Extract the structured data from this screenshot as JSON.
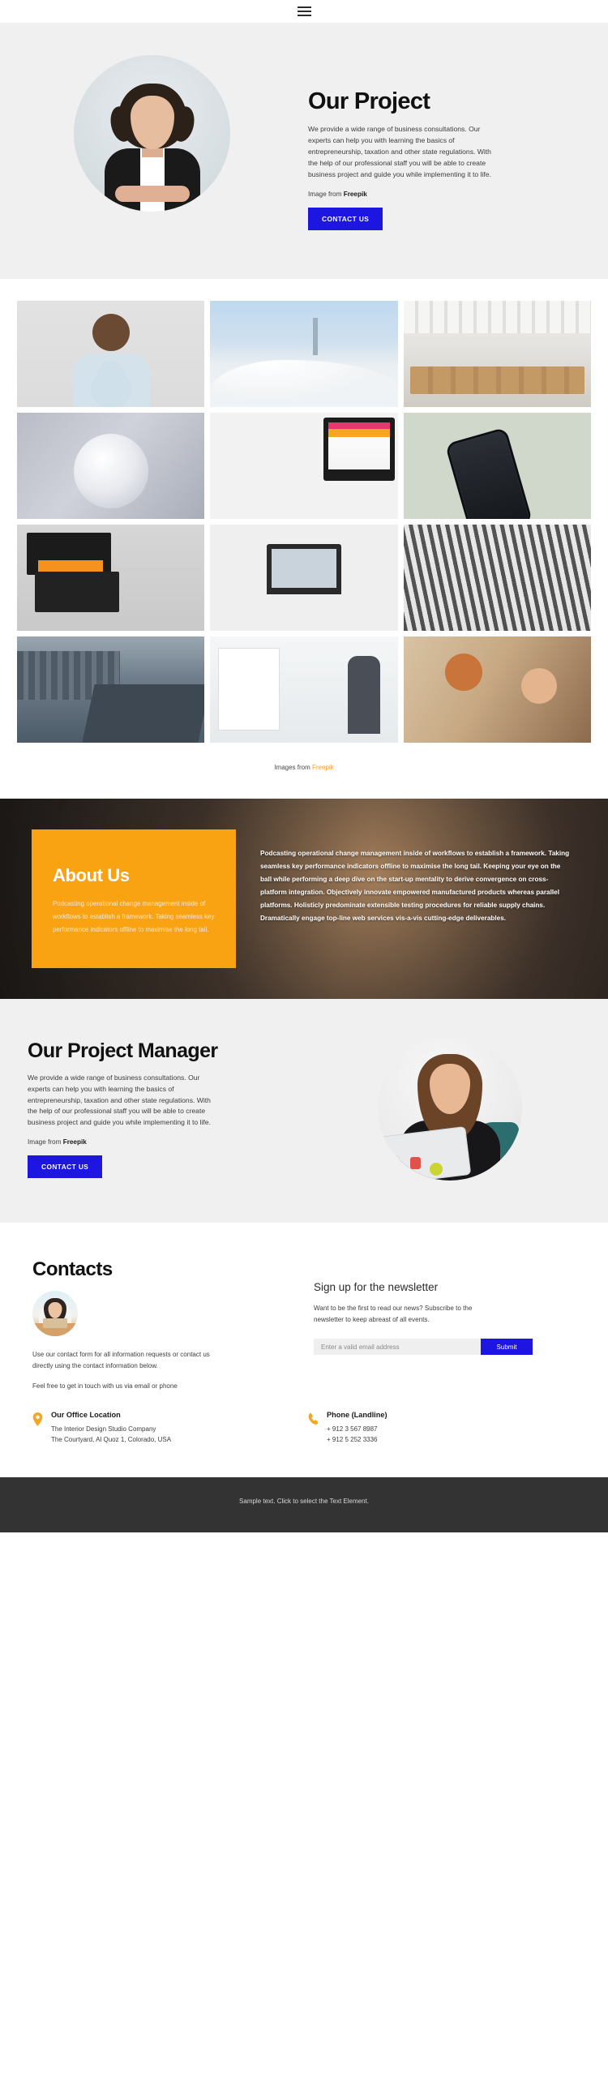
{
  "topbar": {
    "menu_icon": "hamburger-menu-icon"
  },
  "hero": {
    "title": "Our Project",
    "body": "We provide a wide range of business consultations. Our experts can help you with learning the basics of entrepreneurship, taxation and other state regulations. With the help of our professional staff you will be able to create business project and guide you while implementing it to life.",
    "credit_prefix": "Image from ",
    "credit_source": "Freepik",
    "cta_label": "CONTACT US",
    "accent_color": "#1d16e0",
    "background_color": "#f0f0f0"
  },
  "gallery": {
    "credit_prefix": "Images from ",
    "credit_link": "Freepik",
    "link_color": "#f0a029",
    "tiles": [
      {
        "alt": "smiling-man-light-blue-shirt"
      },
      {
        "alt": "skyscraper-above-clouds"
      },
      {
        "alt": "open-plan-office-interior"
      },
      {
        "alt": "white-architectural-dome"
      },
      {
        "alt": "inbound-marketing-strategy-on-monitor"
      },
      {
        "alt": "smartphone-on-green-background"
      },
      {
        "alt": "black-orange-business-cards"
      },
      {
        "alt": "laptop-and-desk-lamp-workspace"
      },
      {
        "alt": "high-rise-building-facade"
      },
      {
        "alt": "city-highway-aerial-view"
      },
      {
        "alt": "woman-writing-on-whiteboard"
      },
      {
        "alt": "two-women-working-at-computer"
      }
    ]
  },
  "about": {
    "heading": "About Us",
    "card_text": "Podcasting operational change management inside of workflows to establish a framework. Taking seamless key performance indicators offline to maximise the long tail.",
    "card_color": "#f9a313",
    "body": "Podcasting operational change management inside of workflows to establish a framework. Taking seamless key performance indicators offline to maximise the long tail. Keeping your eye on the ball while performing a deep dive on the start-up mentality to derive convergence on cross-platform integration. Objectively innovate empowered manufactured products whereas parallel platforms. Holisticly predominate extensible testing procedures for reliable supply chains. Dramatically engage top-line web services vis-a-vis cutting-edge deliverables."
  },
  "project_manager": {
    "title": "Our Project Manager",
    "body": "We provide a wide range of business consultations. Our experts can help you with learning the basics of entrepreneurship, taxation and other state regulations. With the help of our professional staff you will be able to create business project and guide you while implementing it to life.",
    "credit_prefix": "Image from ",
    "credit_source": "Freepik",
    "cta_label": "CONTACT US"
  },
  "contacts": {
    "title": "Contacts",
    "avatar_alt": "woman-working-on-laptop-avatar",
    "paragraph": "Use our contact form for all information requests or contact us directly using the contact information below.",
    "paragraph2": "Feel free to get in touch with us via email or phone",
    "newsletter": {
      "title": "Sign up for the newsletter",
      "description": "Want to be the first to read our news? Subscribe to the newsletter to keep abreast of all events.",
      "input_placeholder": "Enter a valid email address",
      "input_value": "",
      "submit_label": "Submit"
    },
    "office": {
      "icon": "location-pin-icon",
      "heading": "Our Office Location",
      "line1": "The Interior Design Studio Company",
      "line2": "The Courtyard, Al Quoz 1, Colorado,  USA"
    },
    "phone": {
      "icon": "phone-icon",
      "heading": "Phone (Landline)",
      "line1": "+ 912 3 567 8987",
      "line2": "+ 912 5 252 3336"
    },
    "icon_color": "#f5a623"
  },
  "footer": {
    "text": "Sample text. Click to select the Text Element."
  }
}
